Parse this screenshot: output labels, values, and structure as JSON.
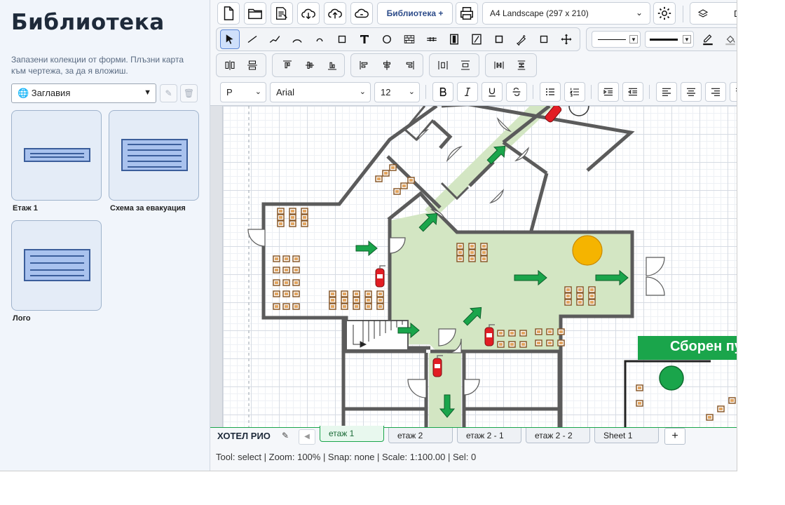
{
  "sidebar": {
    "title": "Библиотека",
    "hint": "Запазени колекции от форми. Плъзни карта към чертежа, за да я вложиш.",
    "collection_select": {
      "value": "🌐 Заглавия"
    },
    "cards": [
      {
        "label": "Етаж 1"
      },
      {
        "label": "Схема за евакуация"
      },
      {
        "label": "Лого"
      }
    ]
  },
  "toolbar": {
    "library_button": "Библиотека +",
    "page_size": "A4 Landscape (297 x 210)",
    "layers_label": "D",
    "paragraph_style": "P",
    "font": "Arial",
    "font_size": "12",
    "icons": [
      "new-file-icon",
      "open-folder-icon",
      "file-list-icon",
      "cloud-download-icon",
      "cloud-upload-icon",
      "cloud-sync-icon",
      "printer-icon",
      "gear-icon",
      "layers-icon"
    ],
    "stroke_color": "#111111"
  },
  "canvas": {
    "assembly_point_label": "Сборен пу",
    "colors": {
      "corridor": "#d3e6c3",
      "wall": "#5b5b5b",
      "arrow": "#1aa54b",
      "extinguisher": "#e21d24",
      "sun": "#f5b400"
    }
  },
  "sheets": {
    "doc_name": "ХОТЕЛ РИО",
    "tabs": [
      {
        "label": "етаж 1",
        "active": true
      },
      {
        "label": "етаж 2",
        "active": false
      },
      {
        "label": "етаж 2 - 1",
        "active": false
      },
      {
        "label": "етаж 2 - 2",
        "active": false
      },
      {
        "label": "Sheet 1",
        "active": false
      }
    ],
    "add_label": "+"
  },
  "status": {
    "text": "Tool: select | Zoom: 100% | Snap: none | Scale: 1:100.00 | Sel: 0"
  }
}
